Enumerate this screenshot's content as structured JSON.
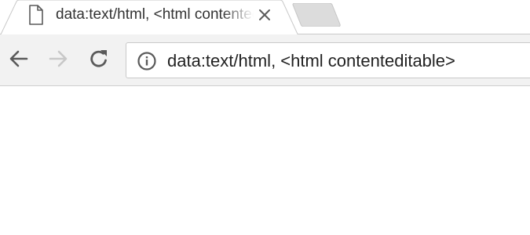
{
  "tab": {
    "title": "data:text/html, <html contenteditable>",
    "favicon": "page-icon",
    "close_icon": "close-icon"
  },
  "new_tab": {
    "icon": "new-tab-icon"
  },
  "toolbar": {
    "back_icon": "arrow-left-icon",
    "forward_icon": "arrow-right-icon",
    "reload_icon": "reload-icon",
    "forward_enabled": false
  },
  "omnibox": {
    "info_icon": "info-icon",
    "url": "data:text/html, <html contenteditable>"
  },
  "colors": {
    "toolbar_bg": "#f2f2f2",
    "tab_active_bg": "#ffffff",
    "tab_inactive_bg": "#dcdcdc",
    "icon_active": "#5a5a5a",
    "icon_disabled": "#c8c8c8",
    "border": "#c9c9c9"
  }
}
